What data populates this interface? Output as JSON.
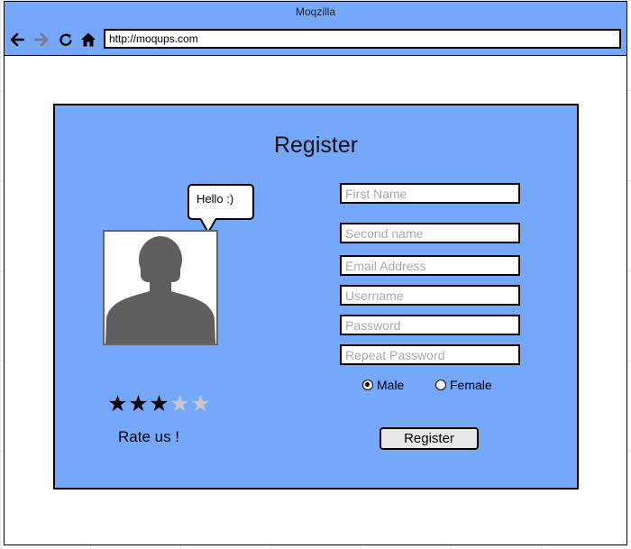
{
  "window": {
    "title": "Moqzilla"
  },
  "toolbar": {
    "back_icon": "arrow-left-icon",
    "forward_icon": "arrow-right-icon",
    "reload_icon": "reload-icon",
    "home_icon": "home-icon",
    "url": "http://moqups.com"
  },
  "form": {
    "title": "Register",
    "bubble_text": "Hello :)",
    "fields": {
      "first_name": "First Name",
      "second_name": "Second name",
      "email": "Email Address",
      "username": "Username",
      "password": "Password",
      "repeat_password": "Repeat Password"
    },
    "gender": {
      "male": "Male",
      "female": "Female",
      "selected": "Male"
    },
    "submit_label": "Register"
  },
  "rating": {
    "label": "Rate us !",
    "value": 3,
    "max": 5
  },
  "colors": {
    "panel_bg": "#75a8fb",
    "star_on": "#000000",
    "star_off": "#c9c9c9"
  }
}
